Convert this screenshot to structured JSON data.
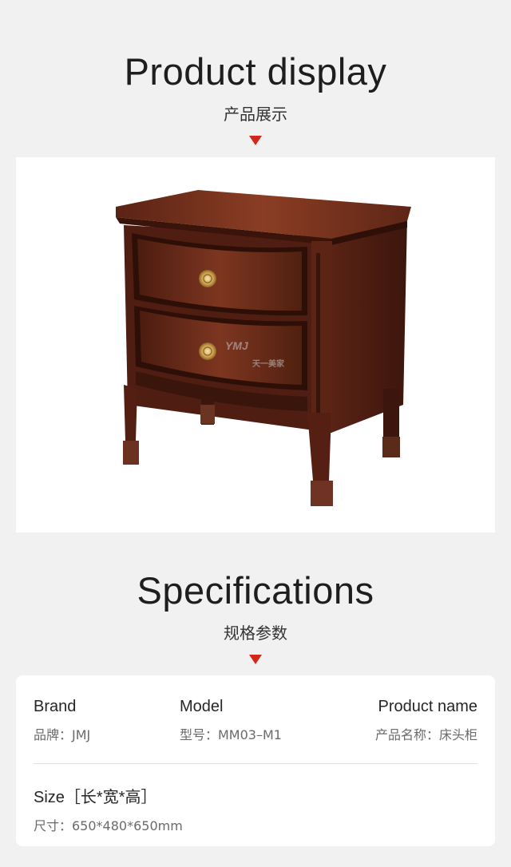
{
  "display": {
    "title": "Product display",
    "subtitle": "产品展示"
  },
  "watermark": {
    "logo": "YMJ",
    "tagline": "天一美家"
  },
  "specs": {
    "title": "Specifications",
    "subtitle": "规格参数",
    "brand": {
      "label": "Brand",
      "value": "品牌：JMJ"
    },
    "model": {
      "label": "Model",
      "value": "型号：MM03–M1"
    },
    "product_name": {
      "label": "Product name",
      "value": "产品名称：床头柜"
    },
    "size": {
      "label": "Size［长*宽*高］",
      "value": "尺寸：650*480*650mm"
    }
  },
  "colors": {
    "accent": "#d1281a",
    "background": "#f1f1f1",
    "wood_dark": "#4e1d12",
    "wood_mid": "#7a3421"
  }
}
